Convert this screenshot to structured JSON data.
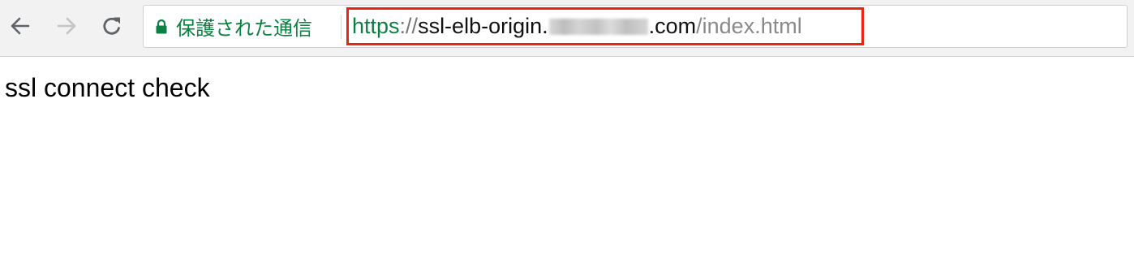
{
  "browser": {
    "security_label": "保護された通信",
    "url": {
      "scheme": "https",
      "separator": "://",
      "host_prefix": "ssl-elb-origin.",
      "host_suffix": ".com",
      "path": "/index.html"
    },
    "colors": {
      "secure": "#0b8043",
      "highlight_box": "#e8260f"
    },
    "icons": {
      "back": "back-arrow-icon",
      "forward": "forward-arrow-icon",
      "reload": "reload-icon",
      "lock": "lock-icon"
    }
  },
  "page": {
    "body_text": "ssl connect check"
  }
}
